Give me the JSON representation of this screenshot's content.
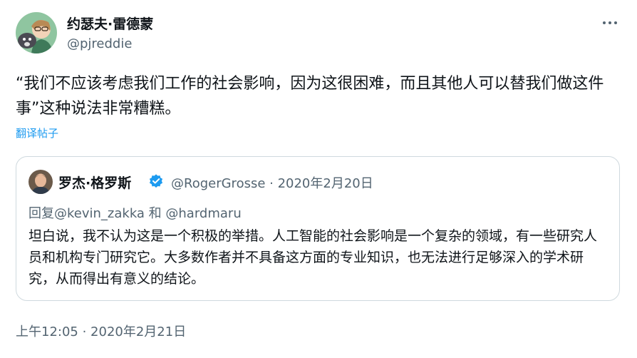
{
  "author": {
    "display_name": "约瑟夫·雷德蒙",
    "handle": "@pjreddie"
  },
  "icons": {
    "more": "more-horizontal-icon",
    "verified": "verified-badge-icon"
  },
  "tweet": {
    "text": "“我们不应该考虑我们工作的社会影响，因为这很困难，而且其他人可以替我们做这件事”这种说法非常糟糕。",
    "translate_label": "翻译帖子",
    "timestamp": "上午12:05 · 2020年2月21日"
  },
  "quote": {
    "display_name": "罗杰·格罗斯",
    "meta": "@RogerGrosse · 2020年2月20日",
    "reply_to": "回复@kevin_zakka 和 @hardmaru",
    "text": "坦白说，我不认为这是一个积极的举措。人工智能的社会影响是一个复杂的领域，有一些研究人员和机构专门研究它。大多数作者并不具备这方面的专业知识，也无法进行足够深入的学术研究，从而得出有意义的结论。"
  },
  "colors": {
    "accent": "#1d9bf0",
    "secondary_text": "#536471",
    "border": "#cfd9de"
  }
}
